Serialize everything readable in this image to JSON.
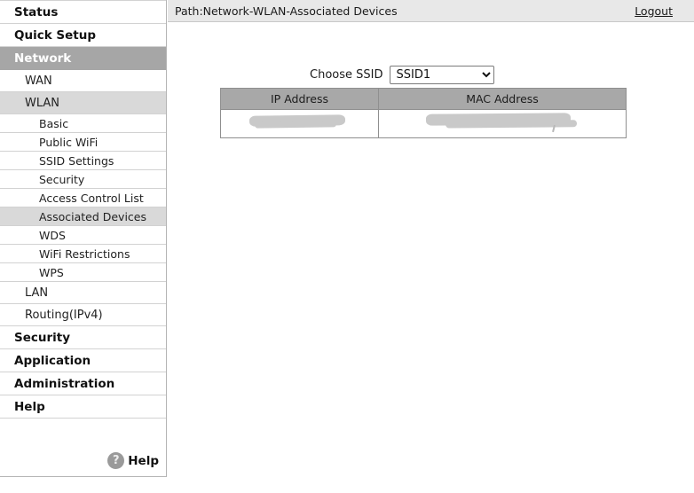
{
  "header": {
    "path_label": "Path:Network-WLAN-Associated Devices",
    "logout_label": "Logout"
  },
  "sidebar": {
    "items": [
      {
        "label": "Status",
        "level": 1,
        "state": "normal"
      },
      {
        "label": "Quick Setup",
        "level": 1,
        "state": "normal"
      },
      {
        "label": "Network",
        "level": 1,
        "state": "active"
      },
      {
        "label": "WAN",
        "level": 2,
        "state": "normal"
      },
      {
        "label": "WLAN",
        "level": 2,
        "state": "open"
      },
      {
        "label": "Basic",
        "level": 3,
        "state": "normal"
      },
      {
        "label": "Public WiFi",
        "level": 3,
        "state": "normal"
      },
      {
        "label": "SSID Settings",
        "level": 3,
        "state": "normal"
      },
      {
        "label": "Security",
        "level": 3,
        "state": "normal"
      },
      {
        "label": "Access Control List",
        "level": 3,
        "state": "normal"
      },
      {
        "label": "Associated Devices",
        "level": 3,
        "state": "selected"
      },
      {
        "label": "WDS",
        "level": 3,
        "state": "normal"
      },
      {
        "label": "WiFi Restrictions",
        "level": 3,
        "state": "normal"
      },
      {
        "label": "WPS",
        "level": 3,
        "state": "normal"
      },
      {
        "label": "LAN",
        "level": 2,
        "state": "normal"
      },
      {
        "label": "Routing(IPv4)",
        "level": 2,
        "state": "normal"
      },
      {
        "label": "Security",
        "level": 1,
        "state": "normal"
      },
      {
        "label": "Application",
        "level": 1,
        "state": "normal"
      },
      {
        "label": "Administration",
        "level": 1,
        "state": "normal"
      },
      {
        "label": "Help",
        "level": 1,
        "state": "normal"
      }
    ],
    "help": {
      "icon": "question-mark-icon",
      "icon_glyph": "?",
      "label": "Help"
    }
  },
  "main": {
    "ssid_chooser": {
      "label": "Choose SSID",
      "selected": "SSID1",
      "options": [
        "SSID1"
      ]
    },
    "table": {
      "columns": [
        "IP Address",
        "MAC Address"
      ],
      "rows": [
        {
          "ip_address": "",
          "mac_address": "",
          "redacted": true
        }
      ]
    }
  },
  "colors": {
    "active_nav": "#a6a6a6",
    "selected_nav": "#d9d9d9",
    "table_header": "#a8a8a8",
    "topbar": "#e8e8e8",
    "redaction": "#c9c9c9"
  }
}
